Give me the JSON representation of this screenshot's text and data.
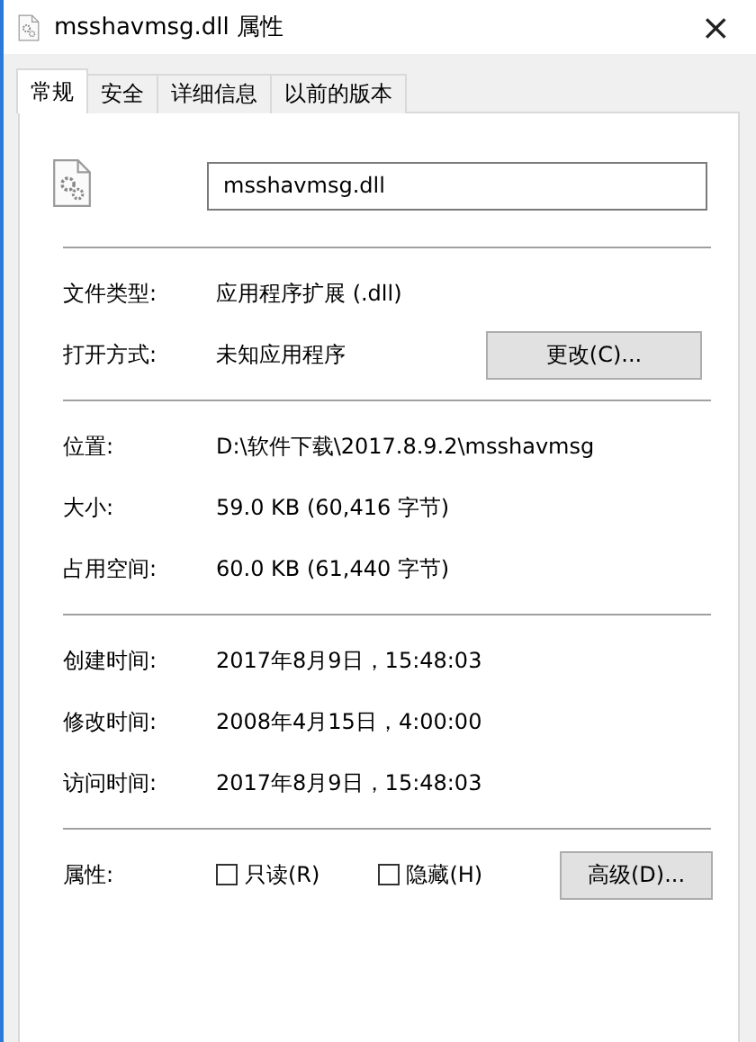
{
  "window": {
    "title": "msshavmsg.dll 属性",
    "close": "×"
  },
  "tabs": [
    {
      "label": "常规",
      "selected": true
    },
    {
      "label": "安全",
      "selected": false
    },
    {
      "label": "详细信息",
      "selected": false
    },
    {
      "label": "以前的版本",
      "selected": false
    }
  ],
  "file_name": "msshavmsg.dll",
  "sections": [
    {
      "rows": [
        {
          "label": "文件类型:",
          "value": "应用程序扩展 (.dll)"
        },
        {
          "label": "打开方式:",
          "value": "未知应用程序",
          "button": "更改(C)..."
        }
      ]
    },
    {
      "rows": [
        {
          "label": "位置:",
          "value": "D:\\软件下载\\2017.8.9.2\\msshavmsg"
        },
        {
          "label": "大小:",
          "value": "59.0 KB (60,416 字节)"
        },
        {
          "label": "占用空间:",
          "value": "60.0 KB (61,440 字节)"
        }
      ]
    },
    {
      "rows": [
        {
          "label": "创建时间:",
          "value": "2017年8月9日，15:48:03"
        },
        {
          "label": "修改时间:",
          "value": "2008年4月15日，4:00:00"
        },
        {
          "label": "访问时间:",
          "value": "2017年8月9日，15:48:03"
        }
      ]
    }
  ],
  "attributes": {
    "label": "属性:",
    "checkboxes": [
      {
        "label": "只读(R)",
        "checked": false
      },
      {
        "label": "隐藏(H)",
        "checked": false
      }
    ],
    "button": "高级(D)..."
  }
}
